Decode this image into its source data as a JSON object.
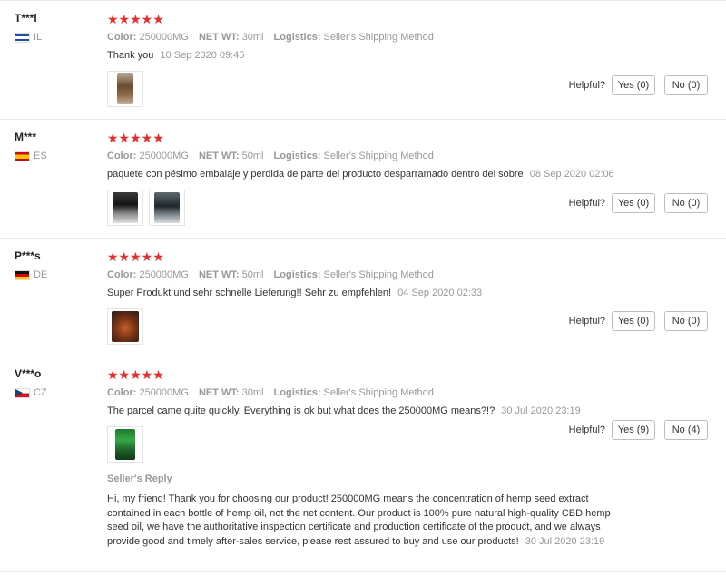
{
  "labels": {
    "color": "Color:",
    "net_wt": "NET WT:",
    "logistics": "Logistics:",
    "helpful": "Helpful?",
    "seller_reply": "Seller's Reply"
  },
  "colors": {
    "star": "#e62e2e",
    "muted_text": "#999999",
    "body_text": "#333333",
    "divider": "#e8e8e8",
    "button_border": "#bdbdbd"
  },
  "reviews": [
    {
      "buyer": "T***l",
      "country": "IL",
      "flag_icon": "israel-flag-icon",
      "rating": 5,
      "stars": "★★★★★",
      "color": "250000MG",
      "net_wt": "30ml",
      "logistics": "Seller's Shipping Method",
      "feedback": "Thank you",
      "date": "10 Sep 2020 09:45",
      "images": [
        "review-photo-icon"
      ],
      "yes_label": "Yes (0)",
      "no_label": "No (0)"
    },
    {
      "buyer": "M***",
      "country": "ES",
      "flag_icon": "spain-flag-icon",
      "rating": 5,
      "stars": "★★★★★",
      "color": "250000MG",
      "net_wt": "50ml",
      "logistics": "Seller's Shipping Method",
      "feedback": "paquete con pésimo embalaje y perdida de parte del producto desparramado dentro del sobre",
      "date": "08 Sep 2020 02:06",
      "images": [
        "review-photo-icon",
        "review-photo-icon"
      ],
      "yes_label": "Yes (0)",
      "no_label": "No (0)"
    },
    {
      "buyer": "P***s",
      "country": "DE",
      "flag_icon": "germany-flag-icon",
      "rating": 5,
      "stars": "★★★★★",
      "color": "250000MG",
      "net_wt": "50ml",
      "logistics": "Seller's Shipping Method",
      "feedback": "Super Produkt und sehr schnelle Lieferung!! Sehr zu empfehlen!",
      "date": "04 Sep 2020 02:33",
      "images": [
        "review-photo-icon"
      ],
      "yes_label": "Yes (0)",
      "no_label": "No (0)"
    },
    {
      "buyer": "V***o",
      "country": "CZ",
      "flag_icon": "czech-flag-icon",
      "rating": 5,
      "stars": "★★★★★",
      "color": "250000MG",
      "net_wt": "30ml",
      "logistics": "Seller's Shipping Method",
      "feedback": "The parcel came quite quickly. Everything is ok but what does the 250000MG means?!?",
      "date": "30 Jul 2020 23:19",
      "images": [
        "review-photo-icon"
      ],
      "yes_label": "Yes (9)",
      "no_label": "No (4)",
      "reply": {
        "text": "Hi, my friend! Thank you for choosing our product! 250000MG means the concentration of hemp seed extract contained in each bottle of hemp oil, not the net content. Our product is 100% pure natural high-quality CBD hemp seed oil, we have the authoritative inspection certificate and production certificate of the product, and we always provide good and timely after-sales service, please rest assured to buy and use our products!",
        "date": "30 Jul 2020 23:19"
      }
    }
  ]
}
